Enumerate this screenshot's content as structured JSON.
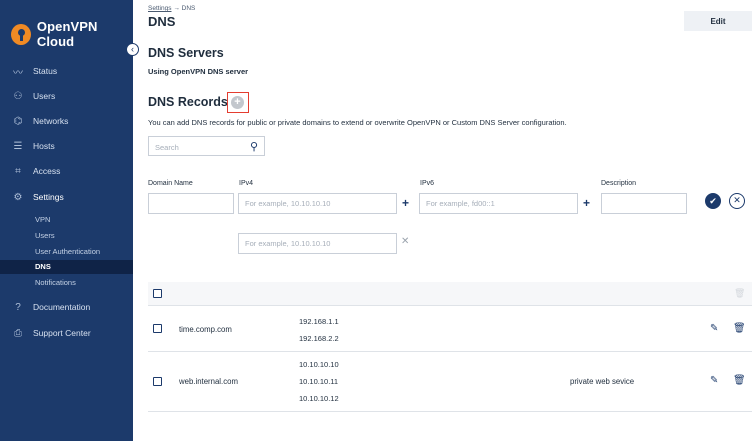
{
  "app": {
    "name": "OpenVPN Cloud"
  },
  "sidebar": {
    "collapse_glyph": "‹",
    "items": [
      {
        "label": "Status",
        "icon": "trend-icon"
      },
      {
        "label": "Users",
        "icon": "users-icon"
      },
      {
        "label": "Networks",
        "icon": "network-icon"
      },
      {
        "label": "Hosts",
        "icon": "hosts-icon"
      },
      {
        "label": "Access",
        "icon": "access-icon"
      },
      {
        "label": "Settings",
        "icon": "gear-icon"
      },
      {
        "label": "Documentation",
        "icon": "help-icon"
      },
      {
        "label": "Support Center",
        "icon": "support-icon"
      }
    ],
    "settings_subitems": [
      "VPN",
      "Users",
      "User Authentication",
      "DNS",
      "Notifications"
    ],
    "selected_subitem": "DNS"
  },
  "breadcrumb": {
    "parent": "Settings",
    "separator": "→",
    "current": "DNS"
  },
  "page": {
    "title": "DNS",
    "edit_label": "Edit"
  },
  "dns_servers": {
    "heading": "DNS Servers",
    "value": "Using OpenVPN DNS server"
  },
  "dns_records": {
    "heading": "DNS Records",
    "add_glyph": "+",
    "description": "You can add DNS records for public or private domains to extend or overwrite OpenVPN or Custom DNS Server configuration."
  },
  "search": {
    "placeholder": "Search",
    "value": ""
  },
  "form": {
    "labels": {
      "domain": "Domain Name",
      "ipv4": "IPv4",
      "ipv6": "IPv6",
      "description": "Description"
    },
    "ipv4_placeholder": "For example, 10.10.10.10",
    "ipv6_placeholder": "For example, fd00::1",
    "second_ipv4_placeholder": "For example, 10.10.10.10",
    "plus_glyph": "+",
    "confirm_glyph": "✔",
    "cancel_glyph": "✕",
    "remove_glyph": "✕"
  },
  "records": [
    {
      "domain": "time.comp.com",
      "ips": [
        "192.168.1.1",
        "192.168.2.2"
      ],
      "description": ""
    },
    {
      "domain": "web.internal.com",
      "ips": [
        "10.10.10.10",
        "10.10.10.11",
        "10.10.10.12"
      ],
      "description": "private web sevice"
    }
  ],
  "colors": {
    "sidebar": "#1c3a6b",
    "highlight": "#e43d30",
    "brand_logo": "#f08a24"
  }
}
